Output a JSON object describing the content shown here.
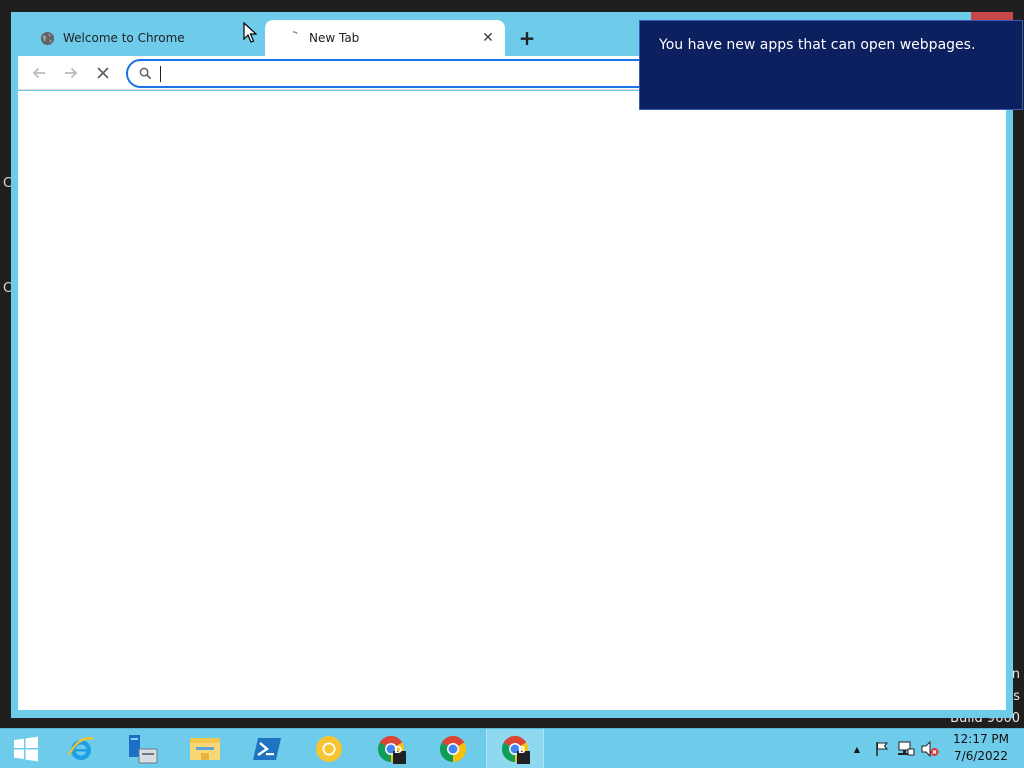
{
  "desktop": {
    "glyph_top": "C",
    "glyph_mid": "C",
    "watermark_lines": [
      "n",
      "s",
      "Build 9600"
    ]
  },
  "browser": {
    "tabs": [
      {
        "title": "Welcome to Chrome",
        "active": false,
        "icon": "globe-icon"
      },
      {
        "title": "New Tab",
        "active": true,
        "icon": "loading-icon",
        "close_label": "✕"
      }
    ],
    "new_tab_label": "+",
    "toolbar": {
      "back_icon": "back-arrow-icon",
      "forward_icon": "forward-arrow-icon",
      "stop_icon": "stop-icon"
    },
    "omnibox": {
      "value": "",
      "placeholder": ""
    }
  },
  "notification": {
    "message": "You have new apps that can open webpages."
  },
  "taskbar": {
    "items": [
      {
        "name": "start-button",
        "icon": "windows-logo-icon"
      },
      {
        "name": "internet-explorer",
        "icon": "ie-icon"
      },
      {
        "name": "server-manager",
        "icon": "server-manager-icon"
      },
      {
        "name": "file-explorer",
        "icon": "folder-icon"
      },
      {
        "name": "powershell",
        "icon": "powershell-icon"
      },
      {
        "name": "chrome-canary",
        "icon": "chrome-yellow-icon"
      },
      {
        "name": "chrome-dev",
        "icon": "chrome-d-icon",
        "badge": "D"
      },
      {
        "name": "chrome",
        "icon": "chrome-icon"
      },
      {
        "name": "chrome-beta",
        "icon": "chrome-b-icon",
        "badge": "B",
        "active": true
      }
    ],
    "tray_up_arrow": "▲",
    "clock": {
      "time": "12:17 PM",
      "date": "7/6/2022"
    }
  },
  "colors": {
    "frame": "#6ecbea",
    "accent": "#1a73e8",
    "toast_bg": "#0c1f5e"
  }
}
